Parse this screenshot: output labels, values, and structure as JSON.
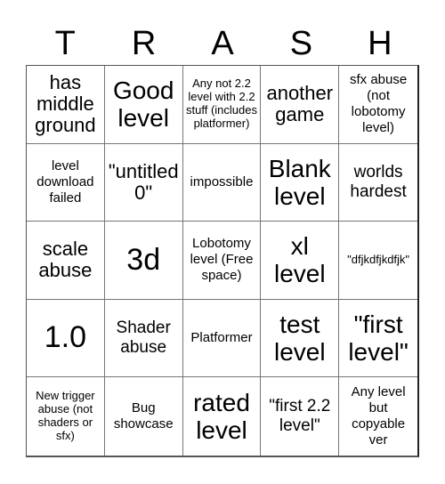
{
  "header": {
    "letters": [
      "T",
      "R",
      "A",
      "S",
      "H"
    ]
  },
  "board": {
    "cells": [
      "has middle ground",
      "Good level",
      "Any not 2.2 level with 2.2 stuff (includes platformer)",
      "another game",
      "sfx abuse (not lobotomy level)",
      "level download failed",
      "\"untitled 0\"",
      "impossible",
      "Blank level",
      "worlds hardest",
      "scale abuse",
      "3d",
      "Lobotomy level (Free space)",
      "xl level",
      "\"dfjkdfjkdfjk\"",
      "1.0",
      "Shader abuse",
      "Platformer",
      "test level",
      "\"first level\"",
      "New trigger abuse (not shaders or sfx)",
      "Bug showcase",
      "rated level",
      "\"first 2.2 level\"",
      "Any level but copyable ver"
    ]
  }
}
